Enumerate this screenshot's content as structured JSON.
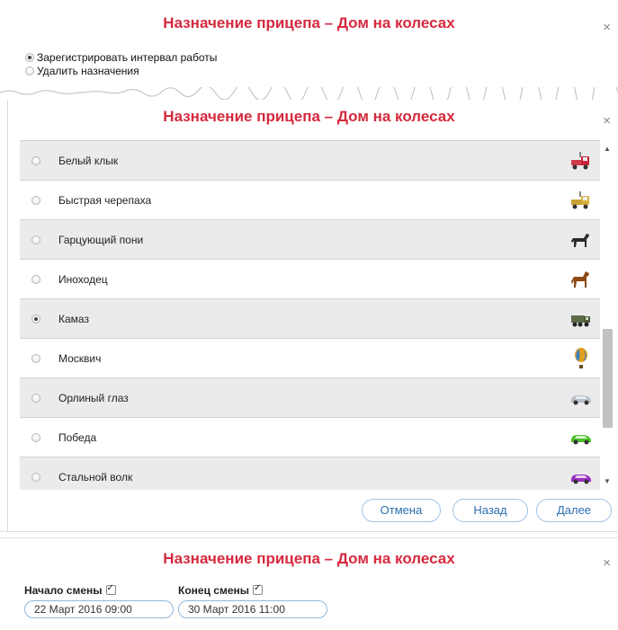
{
  "dialog_title": "Назначение прицепа – Дом на колесах",
  "close_glyph": "×",
  "step1": {
    "options": [
      {
        "label": "Зарегистрировать интервал работы",
        "checked": true
      },
      {
        "label": "Удалить назначения",
        "checked": false
      }
    ]
  },
  "step2": {
    "items": [
      {
        "label": "Белый клык",
        "icon": "red-truck-icon",
        "checked": false
      },
      {
        "label": "Быстрая черепаха",
        "icon": "yellow-truck-icon",
        "checked": false
      },
      {
        "label": "Гарцующий пони",
        "icon": "black-horse-icon",
        "checked": false
      },
      {
        "label": "Иноходец",
        "icon": "brown-horse-icon",
        "checked": false
      },
      {
        "label": "Камаз",
        "icon": "military-truck-icon",
        "checked": true
      },
      {
        "label": "Москвич",
        "icon": "hot-air-balloon-icon",
        "checked": false
      },
      {
        "label": "Орлиный глаз",
        "icon": "silver-car-icon",
        "checked": false
      },
      {
        "label": "Победа",
        "icon": "green-car-icon",
        "checked": false
      },
      {
        "label": "Стальной волк",
        "icon": "purple-car-icon",
        "checked": false
      }
    ],
    "buttons": {
      "cancel": "Отмена",
      "back": "Назад",
      "next": "Далее"
    }
  },
  "step3": {
    "shift_start_label": "Начало смены",
    "shift_end_label": "Конец смены",
    "shift_start_value": "22 Март 2016 09:00",
    "shift_end_value": "30 Март 2016 11:00"
  }
}
